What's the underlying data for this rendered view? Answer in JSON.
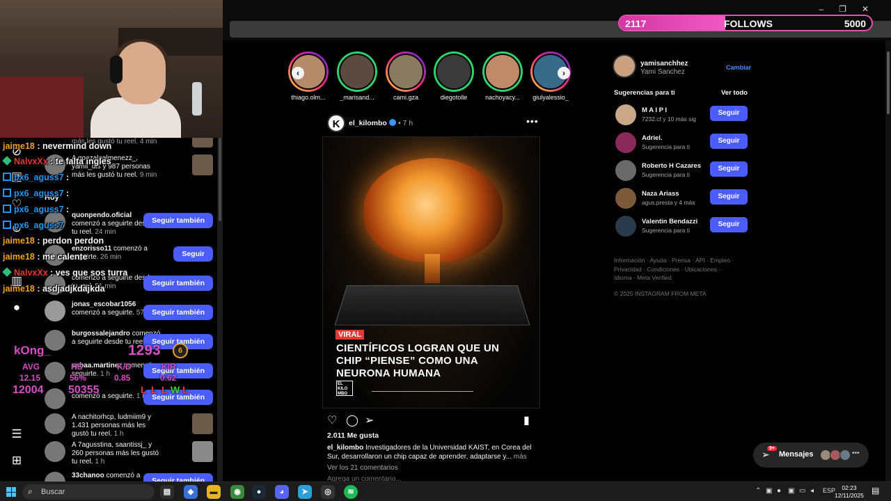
{
  "follow_goal": {
    "current": "2117",
    "label": "FOLLOWS",
    "goal": "5000",
    "progress": 0.42
  },
  "stories": [
    {
      "name": "thiago.olm..."
    },
    {
      "name": "_marisand..."
    },
    {
      "name": "cami.gza"
    },
    {
      "name": "diegotolle"
    },
    {
      "name": "nachoyacy..."
    },
    {
      "name": "giulyalessio_"
    }
  ],
  "post": {
    "avatar_letter": "K",
    "username": "el_kilombo",
    "time": "7 h",
    "more": "•••",
    "tag": "VIRAL",
    "headline": "CIENTÍFICOS LOGRAN QUE UN CHIP “PIENSE” COMO UNA NEURONA HUMANA",
    "logo_text": "EL KILO MBO",
    "likes": "2.011 Me gusta",
    "caption_user": "el_kilombo",
    "caption": "Investigadores de la Universidad KAIST, en Corea del Sur, desarrollaron un chip capaz de aprender, adaptarse y...",
    "caption_more": "más",
    "comments": "Ver los 21 comentarios",
    "add_comment": "Agrega un comentario..."
  },
  "me": {
    "username": "yamisanchhez",
    "name": "Yami Sanchez",
    "switch": "Cambiar"
  },
  "suggestions_header": {
    "title": "Sugerencias para ti",
    "see_all": "Ver todo"
  },
  "suggestions": [
    {
      "user": "M A I P I",
      "sub": "7232.cf y 10 más sig",
      "button": "Seguir"
    },
    {
      "user": "Adriel.",
      "sub": "Sugerencia para ti",
      "button": "Seguir"
    },
    {
      "user": "Roberto H Cazares",
      "sub": "Sugerencia para ti",
      "button": "Seguir"
    },
    {
      "user": "Naza Ariass",
      "sub": "agus.presta y 4 más",
      "button": "Seguir"
    },
    {
      "user": "Valentin Bendazzi",
      "sub": "Sugerencia para ti",
      "button": "Seguir"
    }
  ],
  "footer_links": "Información · Ayuda · Prensa · API · Empleo · Privacidad · Condiciones · Ubicaciones · Idioma · Meta Verified",
  "copyright": "© 2025 INSTAGRAM FROM META",
  "messages": {
    "label": "Mensajes",
    "badge": "9+",
    "dots": "•••"
  },
  "notifications": {
    "section_today": "Hoy",
    "items": [
      {
        "user": "",
        "text": "más les gustó tu reel.",
        "time": "4 min",
        "action": "thumb"
      },
      {
        "user": "",
        "text": "A gonzaloalmenezz_, yamil_dls y 987 personas más les gustó tu reel.",
        "time": "9 min",
        "action": "thumb"
      },
      {
        "user": "quonpendo.oficial",
        "text": "comenzó a seguirte desde tu reel.",
        "time": "24 min",
        "action": "Seguir también"
      },
      {
        "user": "enzorisso11",
        "text": "comenzó a seguirte.",
        "time": "26 min",
        "action": "Seguir"
      },
      {
        "user": "",
        "text": "comenzó a seguirte desde tu reel.",
        "time": "51 min",
        "action": "Seguir también"
      },
      {
        "user": "jonas_escobar1056",
        "text": "comenzó a seguirte.",
        "time": "57 min",
        "action": "Seguir también"
      },
      {
        "user": "burgossalejandro",
        "text": "comenzó a seguirte desde tu reel.",
        "time": "1 h",
        "action": "Seguir también"
      },
      {
        "user": "sabaa.martinez",
        "text": "comenzó a seguirte.",
        "time": "1 h",
        "action": "Seguir también"
      },
      {
        "user": "",
        "text": "comenzó a seguirte.",
        "time": "1 h",
        "action": "Seguir también"
      },
      {
        "user": "",
        "text": "A nachitorhcp, ludmiim9 y 1.431 personas más les gustó tu reel.",
        "time": "1 h",
        "action": "thumb"
      },
      {
        "user": "",
        "text": "A 7agusstina, saantissj_ y 260 personas más les gustó tu reel.",
        "time": "1 h",
        "action": "thumb"
      },
      {
        "user": "33chanoo",
        "text": "comenzó a",
        "time": "",
        "action": "Seguir también"
      }
    ]
  },
  "chat": [
    {
      "user": "jaime18",
      "msg": "nevermind down",
      "color": "#f2a11a",
      "badge": ""
    },
    {
      "user": "NalvxXx",
      "msg": "te falta ingles",
      "color": "#e53935",
      "badge": "diamond"
    },
    {
      "user": "px6_aguss7",
      "msg": "",
      "color": "#2196f3",
      "badge": "prime"
    },
    {
      "user": "px6_aguss7",
      "msg": "",
      "color": "#2196f3",
      "badge": "prime"
    },
    {
      "user": "px6_aguss7",
      "msg": "",
      "color": "#2196f3",
      "badge": "prime"
    },
    {
      "user": "px6_aguss7",
      "msg": "",
      "color": "#2196f3",
      "badge": "prime"
    },
    {
      "user": "jaime18",
      "msg": "perdon perdon",
      "color": "#f2a11a",
      "badge": ""
    },
    {
      "user": "jaime18",
      "msg": "me calente",
      "color": "#f2a11a",
      "badge": ""
    },
    {
      "user": "NalvxXx",
      "msg": "ves que sos turra",
      "color": "#e53935",
      "badge": "diamond"
    },
    {
      "user": "jaime18",
      "msg": "asdjadjkdajkda",
      "color": "#f2a11a",
      "badge": ""
    }
  ],
  "stats": {
    "name": "kOng_",
    "elo": "1293",
    "level": "6",
    "labels": [
      "AVG",
      "HS",
      "K/D",
      "K/R"
    ],
    "values": [
      "12.15",
      "56%",
      "0.85",
      "0.62"
    ],
    "big_left": "12004",
    "big_right": "50355",
    "results": [
      "L",
      "L",
      "L",
      "W",
      "L"
    ]
  },
  "taskbar": {
    "search": "Buscar",
    "lang": "ESP",
    "time": "02:23",
    "date": "12/11/2025"
  },
  "colors": {
    "accent": "#4a5df9",
    "follow_bar": "#e84fb3",
    "chat_name": "#f2a11a"
  }
}
